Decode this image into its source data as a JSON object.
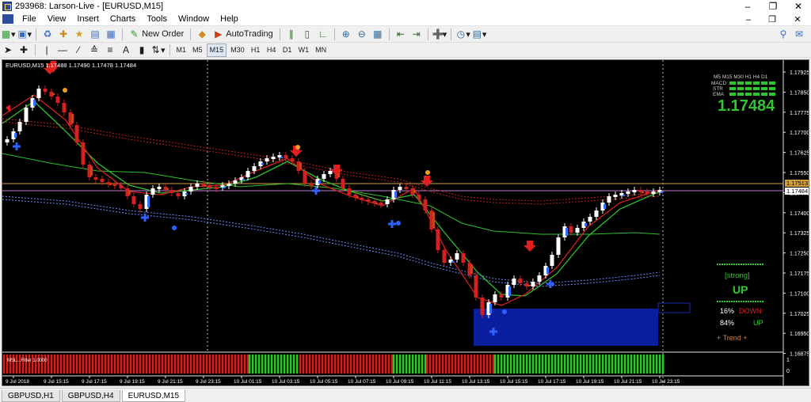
{
  "window": {
    "title": "293968: Larson-Live - [EURUSD,M15]",
    "controls": [
      "minimize",
      "restore",
      "close"
    ]
  },
  "menu": {
    "items": [
      "File",
      "View",
      "Insert",
      "Charts",
      "Tools",
      "Window",
      "Help"
    ]
  },
  "toolbar": {
    "new_order_label": "New Order",
    "autotrading_label": "AutoTrading",
    "timeframes": [
      "M1",
      "M5",
      "M15",
      "M30",
      "H1",
      "H4",
      "D1",
      "W1",
      "MN"
    ],
    "active_timeframe": "M15"
  },
  "chart": {
    "header": "EURUSD,M15  1.17488 1.17490 1.17478 1.17484",
    "price_axis": [
      "1.17925",
      "1.17850",
      "1.17775",
      "1.17700",
      "1.17625",
      "1.17550",
      "1.17475",
      "1.17400",
      "1.17325",
      "1.17250",
      "1.17175",
      "1.17100",
      "1.17025",
      "1.16950",
      "1.16875"
    ],
    "price_tag_orange": "1.17513",
    "price_tag_current": "1.17484",
    "time_axis": [
      "9 Jul 2018",
      "9 Jul 15:15",
      "9 Jul 17:15",
      "9 Jul 19:15",
      "9 Jul 21:15",
      "9 Jul 23:15",
      "10 Jul 01:15",
      "10 Jul 03:15",
      "10 Jul 05:15",
      "10 Jul 07:15",
      "10 Jul 09:15",
      "10 Jul 11:15",
      "10 Jul 13:15",
      "10 Jul 15:15",
      "10 Jul 17:15",
      "10 Jul 19:15",
      "10 Jul 21:15",
      "10 Jul 23:15"
    ],
    "indicator_label": "MSL...Filter 1.0000",
    "indicator_axis": [
      "1",
      "0"
    ],
    "panel": {
      "tf_header": "M5 M15 M30 H1 H4 D1",
      "rows": [
        "MACD",
        "STR",
        "EMA"
      ],
      "big_price": "1.17484",
      "strong_label": "[strong]",
      "direction": "UP",
      "down_pct": "16%",
      "down_label": "DOWN",
      "up_pct": "84%",
      "up_label": "UP",
      "trend_label": "+   Trend   +"
    },
    "colors": {
      "bull": "#ffffff",
      "bear": "#d42020",
      "bull_heikin": "#3070ff",
      "bear_heikin": "#c8421a",
      "ma_fast": "#d02020",
      "ma_mid": "#2fbf2f",
      "accent_green": "#2ec82e"
    }
  },
  "tabs": {
    "items": [
      "GBPUSD,H1",
      "GBPUSD,H4",
      "EURUSD,M15"
    ],
    "active": 2
  }
}
